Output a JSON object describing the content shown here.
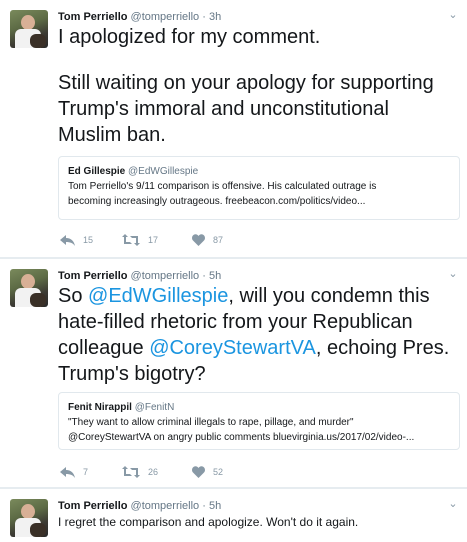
{
  "tweets": [
    {
      "name": "Tom Perriello",
      "handle": "@tomperriello",
      "dot": "·",
      "time": "3h",
      "caret": "⌄",
      "text_line1": "I apologized for my comment.",
      "text_line2": "Still waiting on your apology for supporting Trump's immoral and unconstitutional Muslim ban.",
      "quote": {
        "name": "Ed Gillespie",
        "handle": "@EdWGillespie",
        "text1": "Tom Perriello's 9/11 comparison is offensive. His calculated outrage is",
        "text2": "becoming increasingly outrageous. freebeacon.com/politics/video..."
      },
      "actions": {
        "reply": "15",
        "retweet": "17",
        "like": "87"
      }
    },
    {
      "name": "Tom Perriello",
      "handle": "@tomperriello",
      "dot": "·",
      "time": "5h",
      "caret": "⌄",
      "text_a": "So ",
      "mention1": "@EdWGillespie",
      "text_b": ", will you condemn this hate-filled rhetoric from your Republican colleague ",
      "mention2": "@CoreyStewartVA",
      "text_c": ", echoing Pres. Trump's bigotry?",
      "quote": {
        "name": "Fenit Nirappil",
        "handle": "@FenitN",
        "text1": "\"They want to allow criminal illegals to rape, pillage, and murder\"",
        "text2": "@CoreyStewartVA on angry public comments bluevirginia.us/2017/02/video-..."
      },
      "actions": {
        "reply": "7",
        "retweet": "26",
        "like": "52"
      }
    },
    {
      "name": "Tom Perriello",
      "handle": "@tomperriello",
      "dot": "·",
      "time": "5h",
      "caret": "⌄",
      "text": "I regret the comparison and apologize. Won't do it again."
    }
  ],
  "colors": {
    "link": "#1b95e0",
    "secondary": "#657786",
    "icon": "#8899a6",
    "border": "#e1e8ed"
  },
  "icons": {
    "reply": "reply-icon",
    "retweet": "retweet-icon",
    "like": "heart-icon",
    "caret": "chevron-down-icon"
  }
}
